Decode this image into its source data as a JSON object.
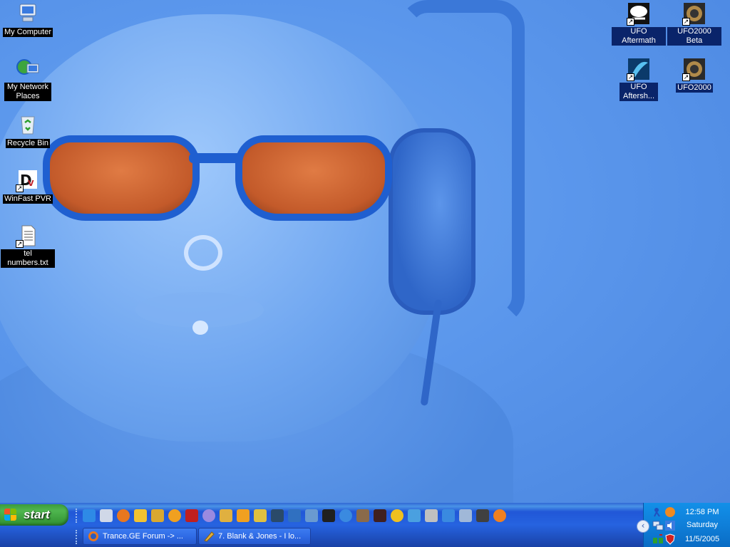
{
  "desktop": {
    "icons_left": [
      {
        "label": "My Computer",
        "icon": "my-computer-icon"
      },
      {
        "label": "My Network Places",
        "icon": "network-places-icon"
      },
      {
        "label": "Recycle Bin",
        "icon": "recycle-bin-icon"
      },
      {
        "label": "WinFast PVR",
        "icon": "winfast-pvr-icon"
      },
      {
        "label": "tel numbers.txt",
        "icon": "text-file-icon"
      }
    ],
    "icons_right": [
      {
        "label": "UFO Aftermath",
        "icon": "ufo-aftermath-icon"
      },
      {
        "label": "UFO2000 Beta",
        "icon": "ufo2000-beta-icon"
      },
      {
        "label": "UFO Aftersh...",
        "icon": "ufo-aftershock-icon"
      },
      {
        "label": "UFO2000",
        "icon": "ufo2000-icon"
      }
    ]
  },
  "taskbar": {
    "start_label": "start",
    "quick_launch_count": 25,
    "tasks": [
      {
        "label": "Trance.GE Forum -> ...",
        "icon": "firefox-icon"
      },
      {
        "label": "7. Blank & Jones - I lo...",
        "icon": "winamp-icon"
      }
    ],
    "clock": {
      "time": "12:58 PM",
      "day": "Saturday",
      "date": "11/5/2005"
    }
  }
}
